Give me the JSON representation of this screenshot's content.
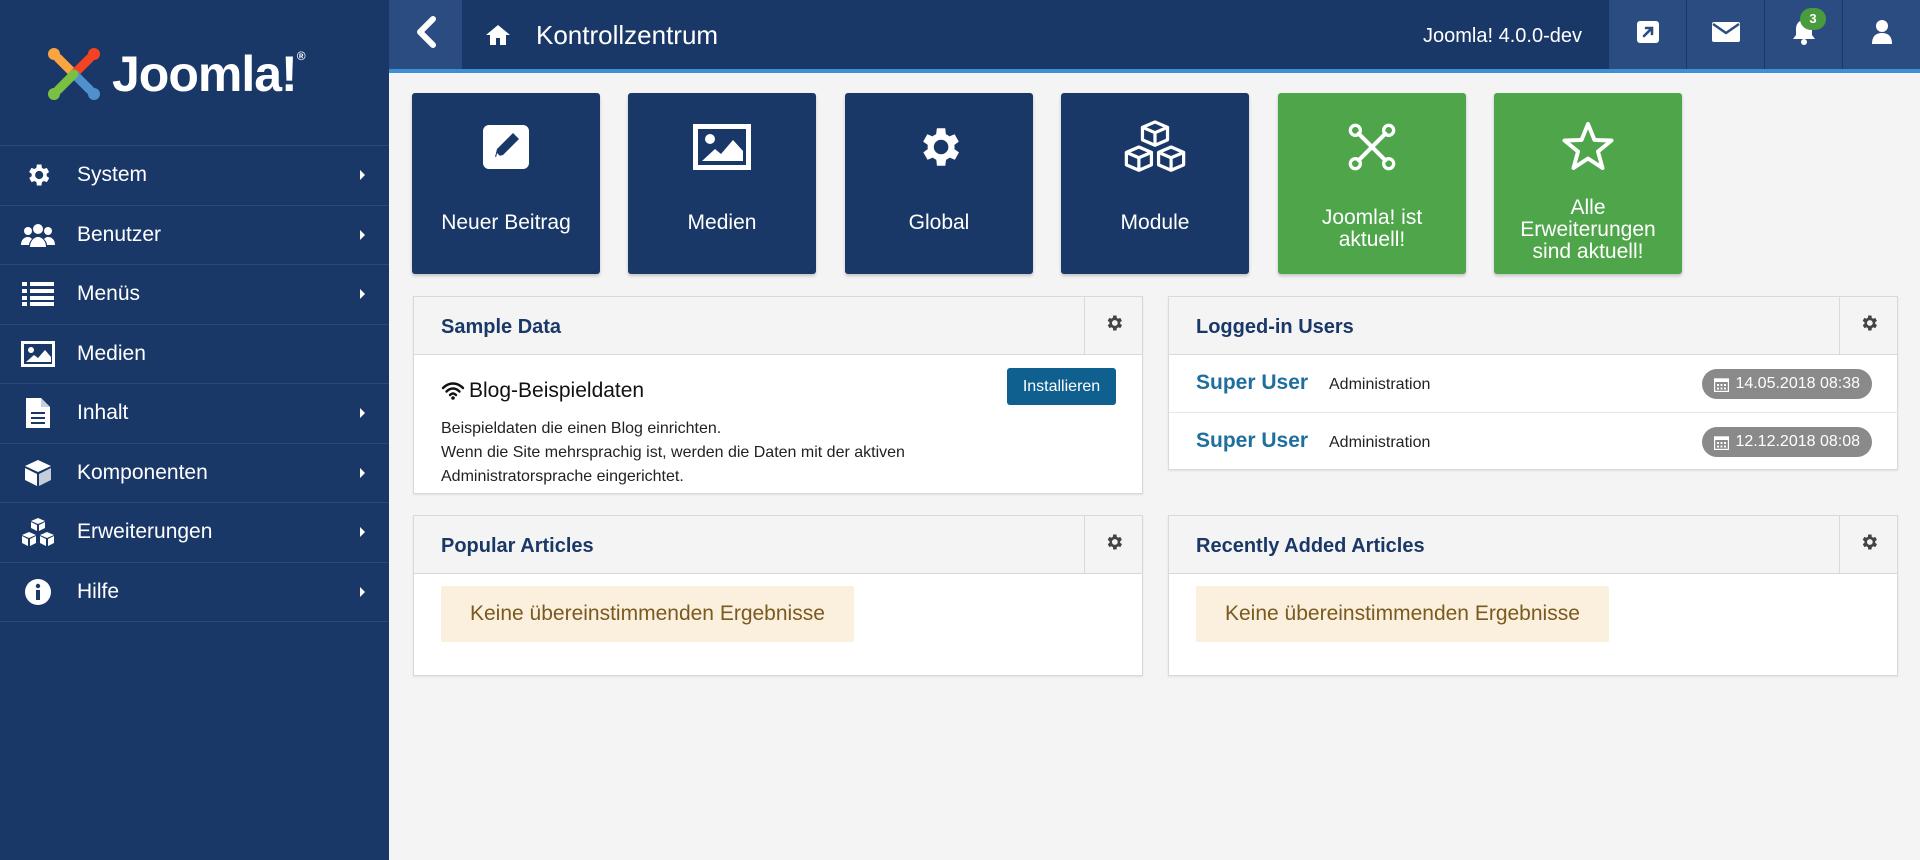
{
  "sidebar": {
    "logo_text": "Joomla!",
    "logo_reg": "®",
    "items": [
      {
        "label": "System",
        "icon": "gear-icon"
      },
      {
        "label": "Benutzer",
        "icon": "users-icon"
      },
      {
        "label": "Menüs",
        "icon": "list-icon"
      },
      {
        "label": "Medien",
        "icon": "image-icon"
      },
      {
        "label": "Inhalt",
        "icon": "file-icon"
      },
      {
        "label": "Komponenten",
        "icon": "cube-icon"
      },
      {
        "label": "Erweiterungen",
        "icon": "cubes-icon"
      },
      {
        "label": "Hilfe",
        "icon": "info-icon"
      }
    ]
  },
  "header": {
    "title": "Kontrollzentrum",
    "version": "Joomla! 4.0.0-dev",
    "notification_count": "3"
  },
  "quickicons": [
    {
      "label": "Neuer Beitrag",
      "icon": "pencil-square-icon",
      "color": "#1a3867"
    },
    {
      "label": "Medien",
      "icon": "image-icon",
      "color": "#1a3867"
    },
    {
      "label": "Global",
      "icon": "gear-icon",
      "color": "#1a3867"
    },
    {
      "label": "Module",
      "icon": "cubes-icon",
      "color": "#1a3867"
    },
    {
      "label": "Joomla! ist aktuell!",
      "icon": "joomla-icon",
      "color": "#4ea54a"
    },
    {
      "label": "Alle Erweiterungen sind aktuell!",
      "icon": "star-icon",
      "color": "#4ea54a"
    }
  ],
  "sample_data": {
    "title": "Sample Data",
    "item_title": "Blog-Beispieldaten",
    "desc_line1": "Beispieldaten die einen Blog einrichten.",
    "desc_line2": "Wenn die Site mehrsprachig ist, werden die Daten mit der aktiven Administratorsprache eingerichtet.",
    "install_label": "Installieren"
  },
  "logged_in": {
    "title": "Logged-in Users",
    "users": [
      {
        "name": "Super User",
        "role": "Administration",
        "date": "14.05.2018 08:38"
      },
      {
        "name": "Super User",
        "role": "Administration",
        "date": "12.12.2018 08:08"
      }
    ]
  },
  "popular": {
    "title": "Popular Articles",
    "empty": "Keine übereinstimmenden Ergebnisse"
  },
  "recent": {
    "title": "Recently Added Articles",
    "empty": "Keine übereinstimmenden Ergebnisse"
  },
  "colors": {
    "sidebar_bg": "#1a3867",
    "accent_blue": "#3d8fd6",
    "tile_green": "#4ea54a",
    "button_blue": "#0f5f8f"
  }
}
